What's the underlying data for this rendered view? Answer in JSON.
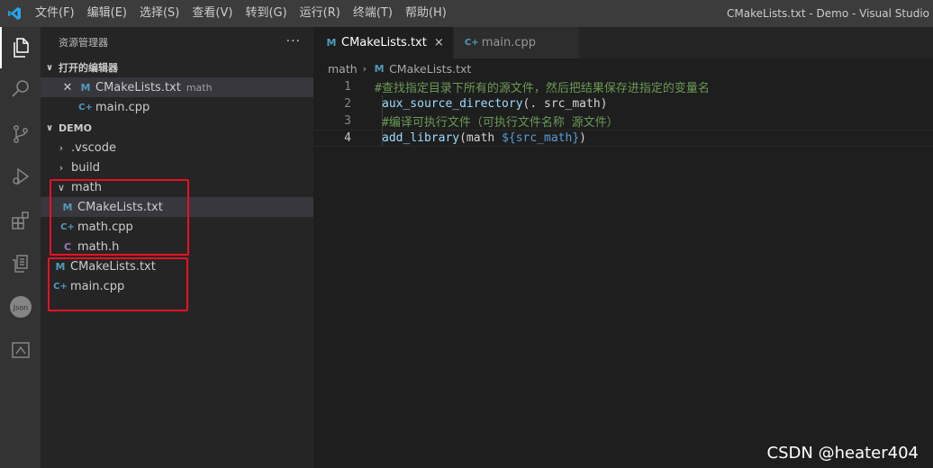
{
  "titlebar": {
    "menu": [
      "文件(F)",
      "编辑(E)",
      "选择(S)",
      "查看(V)",
      "转到(G)",
      "运行(R)",
      "终端(T)",
      "帮助(H)"
    ],
    "window_title": "CMakeLists.txt - Demo - Visual Studio"
  },
  "activity_icons": [
    "files-icon",
    "search-icon",
    "source-control-icon",
    "run-debug-icon",
    "extensions-icon",
    "remote-icon",
    "json-icon",
    "panel-icon"
  ],
  "sidebar": {
    "title": "资源管理器",
    "more": "···",
    "open_editors": {
      "header": "打开的编辑器",
      "items": [
        {
          "label": "CMakeLists.txt",
          "description": "math",
          "icon": "M"
        },
        {
          "label": "main.cpp",
          "icon": "C+"
        }
      ]
    },
    "project": {
      "header": "DEMO",
      "folders": [
        {
          "label": ".vscode"
        },
        {
          "label": "build"
        },
        {
          "label": "math"
        }
      ],
      "math_children": [
        {
          "label": "CMakeLists.txt",
          "icon": "M"
        },
        {
          "label": "math.cpp",
          "icon": "C+"
        },
        {
          "label": "math.h",
          "icon": "C"
        }
      ],
      "root_files": [
        {
          "label": "CMakeLists.txt",
          "icon": "M"
        },
        {
          "label": "main.cpp",
          "icon": "C+"
        }
      ]
    }
  },
  "tabs": [
    {
      "label": "CMakeLists.txt",
      "icon": "M",
      "close": "×"
    },
    {
      "label": "main.cpp",
      "icon": "C+"
    }
  ],
  "breadcrumb": {
    "folder": "math",
    "file": "CMakeLists.txt"
  },
  "editor": {
    "lines": [
      {
        "num": "1",
        "comment": "#查找指定目录下所有的源文件，然后把结果保存进指定的变量名"
      },
      {
        "num": "2",
        "func": "aux_source_directory",
        "rest": "(. src_math)"
      },
      {
        "num": "3",
        "comment": "#编译可执行文件（可执行文件名称 源文件）"
      },
      {
        "num": "4",
        "func": "add_library",
        "rest_a": "(math ",
        "var": "${src_math}",
        "rest_b": ")"
      }
    ]
  },
  "watermark": "CSDN @heater404",
  "colors": {
    "accent": "#007acc",
    "highlight_box": "#e81123"
  }
}
